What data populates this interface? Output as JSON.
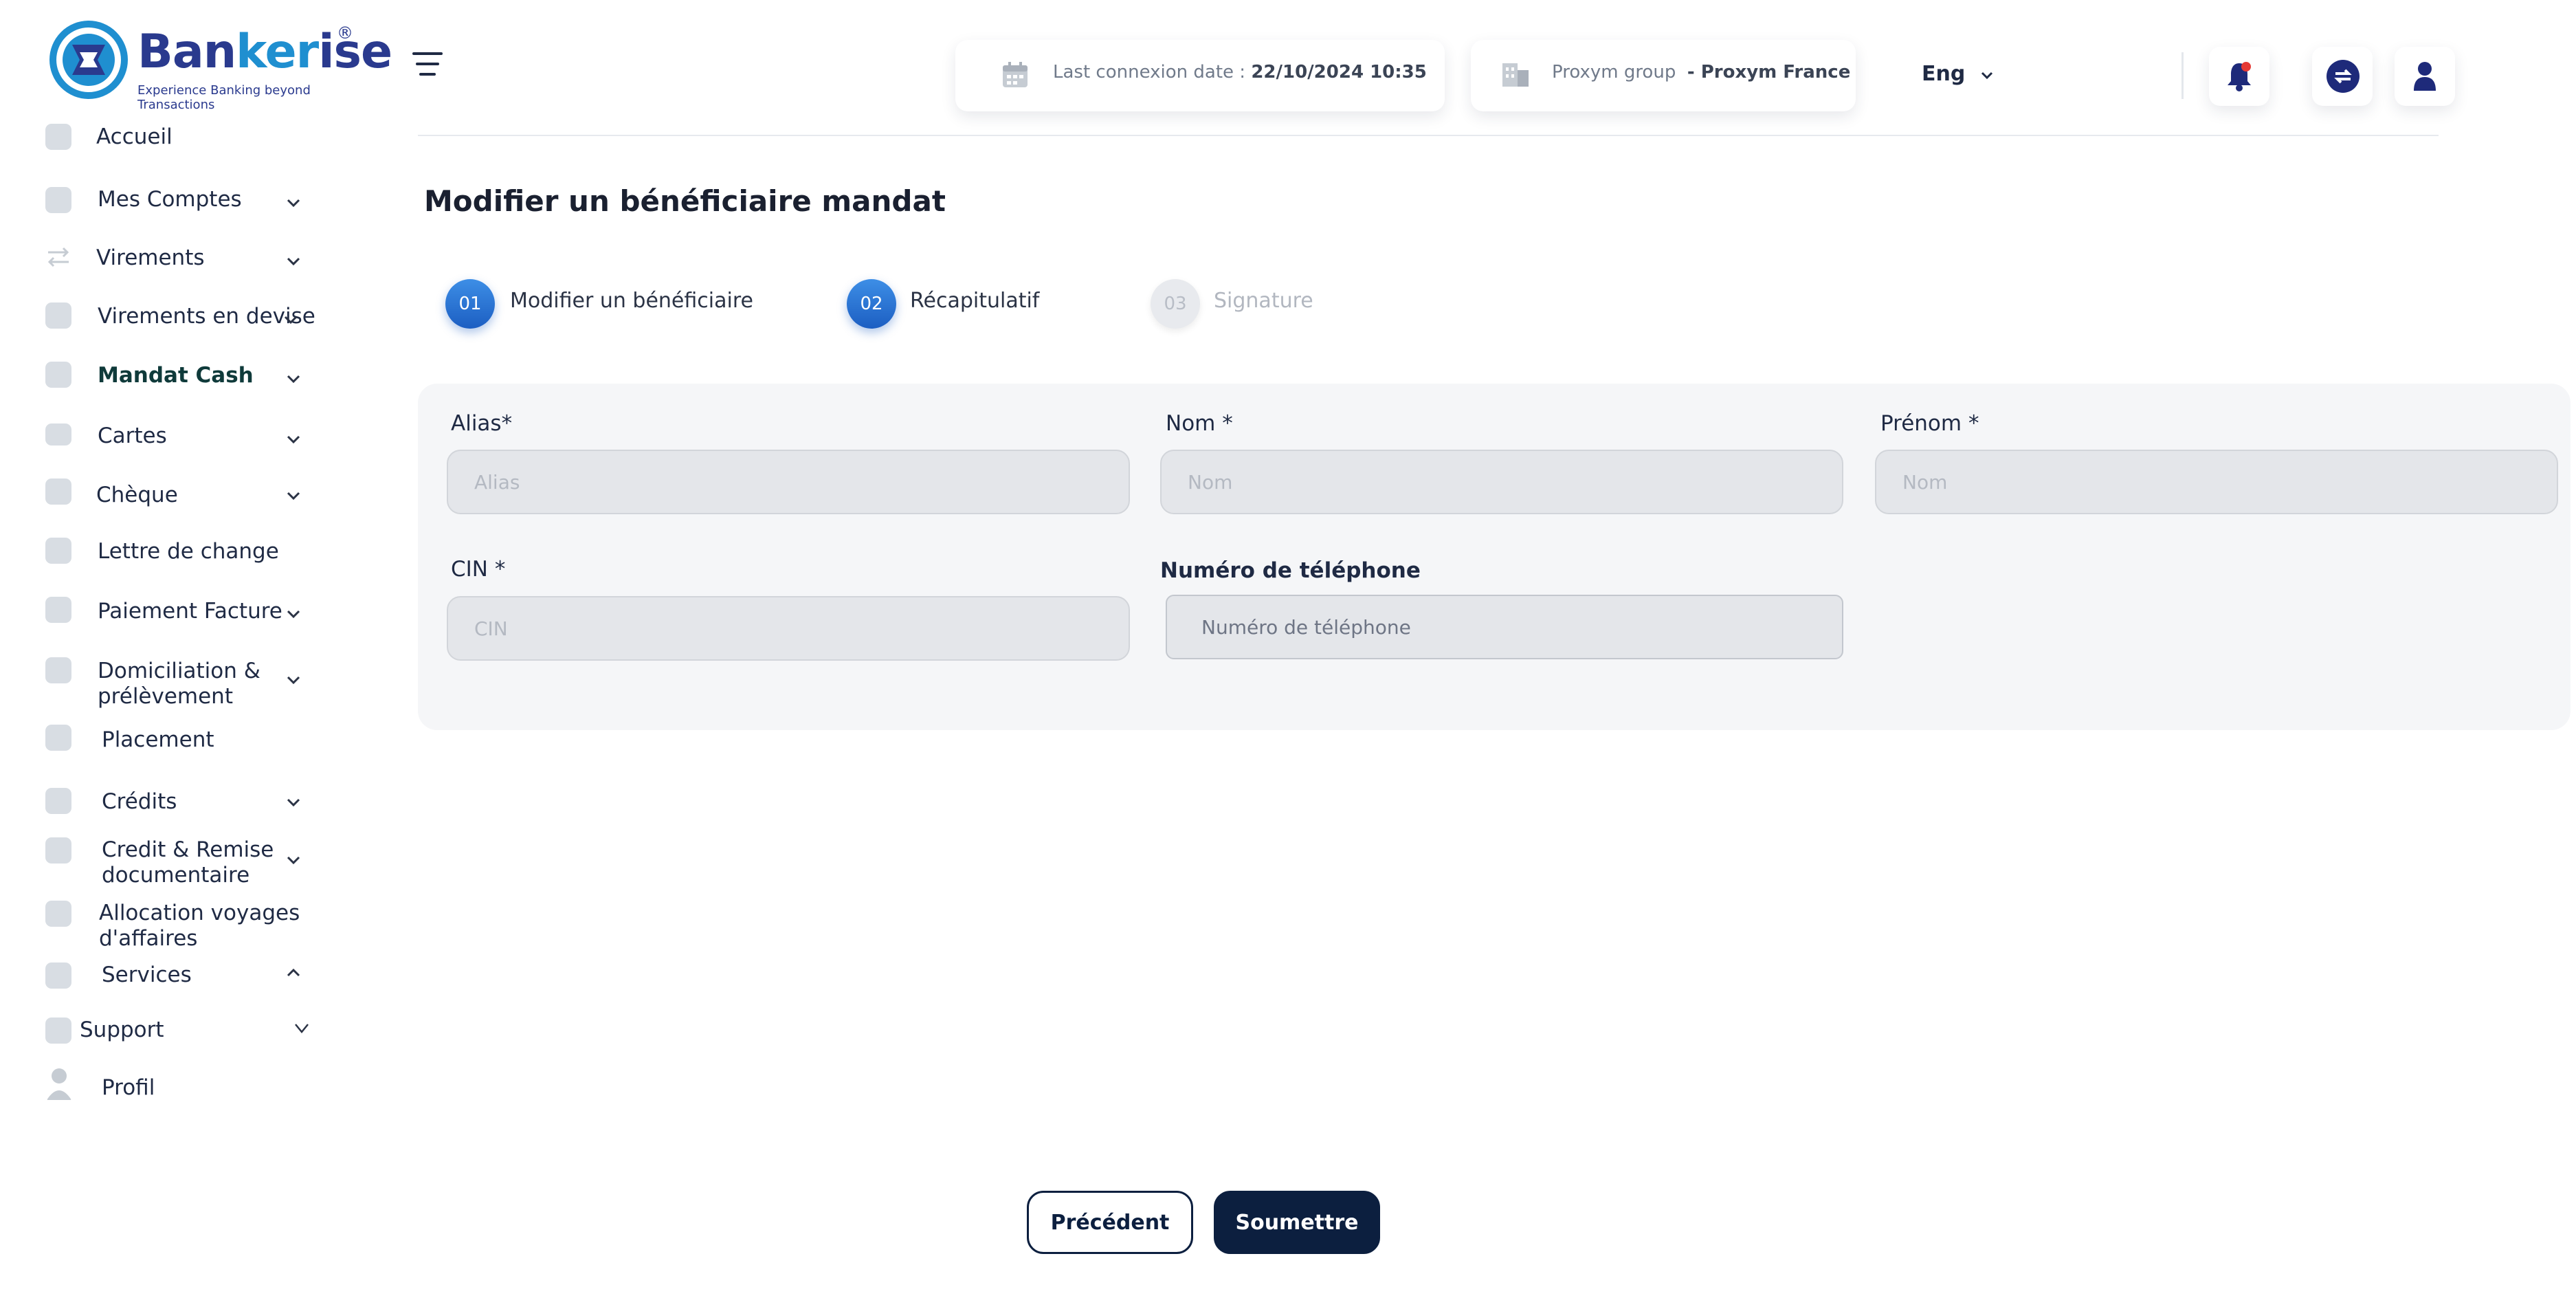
{
  "brand": {
    "name_part1": "Ban",
    "name_part2": "ker",
    "name_part3": "ise",
    "registered": "®",
    "tagline": "Experience Banking beyond Transactions"
  },
  "sidebar": {
    "items": [
      {
        "label": "Accueil",
        "icon": "home-icon",
        "expandable": false
      },
      {
        "label": "Mes Comptes",
        "icon": "folder-icon",
        "expandable": true
      },
      {
        "label": "Virements",
        "icon": "transfer-icon",
        "expandable": true
      },
      {
        "label": "Virements en devise",
        "icon": "currency-icon",
        "expandable": true
      },
      {
        "label": "Mandat Cash",
        "icon": "mail-icon",
        "expandable": true,
        "active": true
      },
      {
        "label": "Cartes",
        "icon": "card-icon",
        "expandable": true
      },
      {
        "label": "Chèque",
        "icon": "cheque-icon",
        "expandable": true
      },
      {
        "label": "Lettre de change",
        "icon": "mail-icon",
        "expandable": false
      },
      {
        "label": "Paiement Facture",
        "icon": "invoice-icon",
        "expandable": true
      },
      {
        "label": "Domiciliation & prélèvement",
        "icon": "mail-icon",
        "expandable": true
      },
      {
        "label": "Placement",
        "icon": "chart-icon",
        "expandable": false
      },
      {
        "label": "Crédits",
        "icon": "mail-icon",
        "expandable": true
      },
      {
        "label": "Credit & Remise documentaire",
        "icon": "mail-icon",
        "expandable": true
      },
      {
        "label": "Allocation  voyages d'affaires",
        "icon": "mail-icon",
        "expandable": false
      },
      {
        "label": "Services",
        "icon": "mail-icon",
        "expandable": true,
        "expanded": true
      },
      {
        "label": "Support",
        "icon": "support-icon",
        "expandable": true
      },
      {
        "label": "Profil",
        "icon": "user-icon",
        "expandable": false
      }
    ]
  },
  "header": {
    "last_connexion_label": "Last connexion date :",
    "last_connexion_value": "22/10/2024 10:35",
    "group_label": "Proxym group",
    "group_value": "- Proxym France",
    "language": "Eng"
  },
  "page": {
    "title": "Modifier  un bénéficiaire mandat",
    "steps": [
      {
        "number": "01",
        "label": "Modifier un bénéficiaire",
        "state": "done"
      },
      {
        "number": "02",
        "label": "Récapitulatif",
        "state": "current"
      },
      {
        "number": "03",
        "label": "Signature",
        "state": "pending"
      }
    ]
  },
  "form": {
    "alias": {
      "label": "Alias*",
      "placeholder": "Alias",
      "value": ""
    },
    "nom": {
      "label": "Nom *",
      "placeholder": "Nom",
      "value": ""
    },
    "prenom": {
      "label": "Prénom *",
      "placeholder": "Nom",
      "value": ""
    },
    "cin": {
      "label": "CIN *",
      "placeholder": "CIN",
      "value": ""
    },
    "telephone": {
      "label": "Numéro de téléphone",
      "placeholder": "Numéro de téléphone",
      "value": ""
    }
  },
  "actions": {
    "previous": "Précédent",
    "submit": "Soumettre"
  },
  "colors": {
    "primary": "#0c1f3f",
    "accent": "#1f6fd0",
    "brand": "#2a3a8e",
    "notification_dot": "#e53935"
  }
}
